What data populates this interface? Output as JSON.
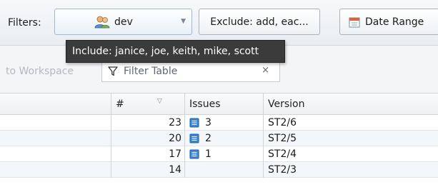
{
  "filterbar": {
    "label": "Filters:",
    "include_button": {
      "label": "dev",
      "icon": "users-icon"
    },
    "exclude_button": {
      "label": "Exclude: add, eac..."
    },
    "date_button": {
      "label": "Date Range",
      "icon": "calendar-icon"
    }
  },
  "tooltip": {
    "text": "Include: janice, joe, keith, mike, scott"
  },
  "toolbar": {
    "workspace_text": "to Workspace",
    "filter_table_placeholder": "Filter Table",
    "clear_glyph": "×"
  },
  "table": {
    "headers": {
      "num": "#",
      "issues": "Issues",
      "version": "Version"
    },
    "rows": [
      {
        "num": "23",
        "issues": "3",
        "version": "ST2/6"
      },
      {
        "num": "20",
        "issues": "2",
        "version": "ST2/5"
      },
      {
        "num": "17",
        "issues": "1",
        "version": "ST2/4"
      },
      {
        "num": "14",
        "issues": "",
        "version": "ST2/3"
      }
    ]
  },
  "colors": {
    "accent": "#3a7bd5",
    "tooltip_bg": "#3b3b3b"
  }
}
